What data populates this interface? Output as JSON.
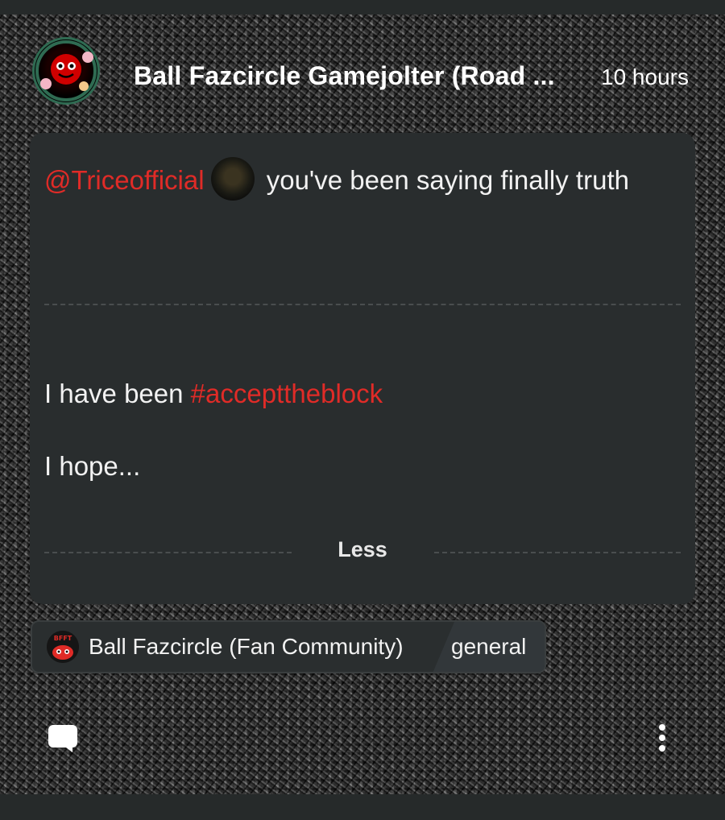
{
  "post": {
    "author_name": "Ball Fazcircle Gamejolter (Road ...",
    "time": "10 hours",
    "mention": "@Triceofficial",
    "lead_text": " you've been saying finally truth",
    "paragraph1_text": "I have been ",
    "hashtag": "#accepttheblock",
    "paragraph2_text": "I hope...",
    "less_label": "Less"
  },
  "community": {
    "name": "Ball Fazcircle (Fan Community)",
    "channel": "general",
    "icon_text": "BFFT"
  },
  "actions": {
    "comment_icon": "comment-bubble-icon",
    "more_icon": "vertical-ellipsis-icon"
  },
  "colors": {
    "accent_red": "#e02b27",
    "card_bg": "#292d2e",
    "bar_bg": "#262a2a"
  }
}
